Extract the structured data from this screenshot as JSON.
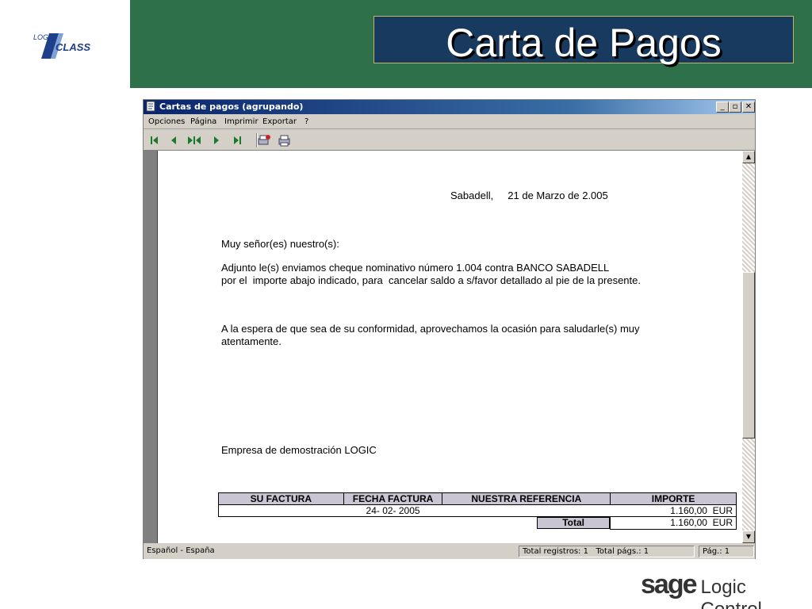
{
  "slide": {
    "title": "Carta de Pagos",
    "logo_top": "LOGIC",
    "logo_bottom": "CLASS",
    "footer_brand": "sage",
    "footer_product": "Logic Control",
    "colors": {
      "header_green": "#2d7049",
      "title_box": "#183a5f",
      "title_border": "#c9b560"
    }
  },
  "window": {
    "title": "Cartas de pagos (agrupando)",
    "controls": [
      "_",
      "▫",
      "✕"
    ],
    "menu": [
      "Opciones",
      "Página",
      "Imprimir",
      "Exportar",
      "?"
    ],
    "toolbar": {
      "icons": [
        "first-page-icon",
        "previous-page-icon",
        "go-to-page-icon",
        "next-page-icon",
        "last-page-icon",
        "print-setup-icon",
        "print-icon"
      ]
    }
  },
  "document": {
    "place_date": "Sabadell,     21 de Marzo de 2.005",
    "greeting": "Muy señor(es) nuestro(s):",
    "body_line1": "Adjunto le(s) enviamos cheque nominativo número 1.004 contra BANCO SABADELL",
    "body_line2": "por el  importe abajo indicado, para  cancelar saldo a s/favor detallado al pie de la presente.",
    "closing_line1": "A la espera de que sea de su conformidad, aprovechamos la ocasión para saludarle(s) muy",
    "closing_line2": "atentamente.",
    "company": "Empresa de demostración LOGIC",
    "table": {
      "headers": [
        "SU FACTURA",
        "FECHA FACTURA",
        "NUESTRA REFERENCIA",
        "IMPORTE"
      ],
      "row": {
        "invoice": "",
        "date": "24- 02- 2005",
        "reference": "",
        "amount": "1.160,00",
        "currency": "EUR"
      },
      "total_label": "Total",
      "total_amount": "1.160,00",
      "total_currency": "EUR"
    }
  },
  "statusbar": {
    "locale": "Español - España",
    "total_records": "Total registros: 1",
    "total_pages": "Total págs.: 1",
    "page": "Pág.: 1"
  }
}
